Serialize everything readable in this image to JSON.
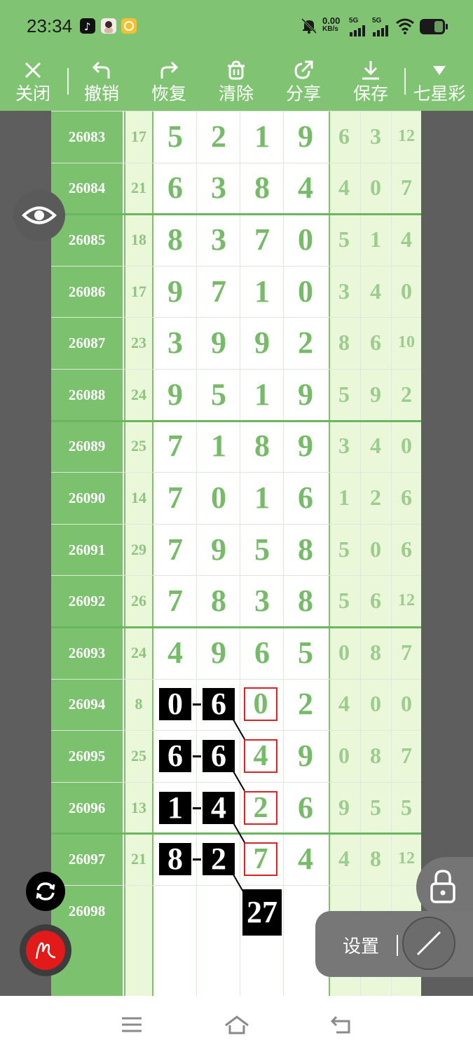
{
  "status_bar": {
    "time": "23:34",
    "speed_value": "0.00",
    "speed_unit": "KB/s",
    "network1": "5G",
    "network2": "5G"
  },
  "toolbar": {
    "close": "关闭",
    "undo": "撤销",
    "redo": "恢复",
    "clear": "清除",
    "share": "分享",
    "save": "保存",
    "lottery": "七星彩"
  },
  "rows": [
    {
      "id": "26083",
      "sum": "17",
      "digits": [
        "5",
        "2",
        "1",
        "9"
      ],
      "tail": [
        "6",
        "3",
        "12"
      ]
    },
    {
      "id": "26084",
      "sum": "21",
      "digits": [
        "6",
        "3",
        "8",
        "4"
      ],
      "tail": [
        "4",
        "0",
        "7"
      ]
    },
    {
      "id": "26085",
      "sum": "18",
      "digits": [
        "8",
        "3",
        "7",
        "0"
      ],
      "tail": [
        "5",
        "1",
        "4"
      ]
    },
    {
      "id": "26086",
      "sum": "17",
      "digits": [
        "9",
        "7",
        "1",
        "0"
      ],
      "tail": [
        "3",
        "4",
        "0"
      ]
    },
    {
      "id": "26087",
      "sum": "23",
      "digits": [
        "3",
        "9",
        "9",
        "2"
      ],
      "tail": [
        "8",
        "6",
        "10"
      ]
    },
    {
      "id": "26088",
      "sum": "24",
      "digits": [
        "9",
        "5",
        "1",
        "9"
      ],
      "tail": [
        "5",
        "9",
        "2"
      ]
    },
    {
      "id": "26089",
      "sum": "25",
      "digits": [
        "7",
        "1",
        "8",
        "9"
      ],
      "tail": [
        "3",
        "4",
        "0"
      ]
    },
    {
      "id": "26090",
      "sum": "14",
      "digits": [
        "7",
        "0",
        "1",
        "6"
      ],
      "tail": [
        "1",
        "2",
        "6"
      ]
    },
    {
      "id": "26091",
      "sum": "29",
      "digits": [
        "7",
        "9",
        "5",
        "8"
      ],
      "tail": [
        "5",
        "0",
        "6"
      ]
    },
    {
      "id": "26092",
      "sum": "26",
      "digits": [
        "7",
        "8",
        "3",
        "8"
      ],
      "tail": [
        "5",
        "6",
        "12"
      ]
    },
    {
      "id": "26093",
      "sum": "24",
      "digits": [
        "4",
        "9",
        "6",
        "5"
      ],
      "tail": [
        "0",
        "8",
        "7"
      ]
    },
    {
      "id": "26094",
      "sum": "8",
      "digits": [
        "0",
        "6",
        "0",
        "2"
      ],
      "tail": [
        "4",
        "0",
        "0"
      ]
    },
    {
      "id": "26095",
      "sum": "25",
      "digits": [
        "6",
        "6",
        "4",
        "9"
      ],
      "tail": [
        "0",
        "8",
        "7"
      ]
    },
    {
      "id": "26096",
      "sum": "13",
      "digits": [
        "1",
        "4",
        "2",
        "6"
      ],
      "tail": [
        "9",
        "5",
        "5"
      ]
    },
    {
      "id": "26097",
      "sum": "21",
      "digits": [
        "8",
        "2",
        "7",
        "4"
      ],
      "tail": [
        "4",
        "8",
        "12"
      ]
    },
    {
      "id": "26098",
      "sum": "",
      "digits": [
        "",
        "",
        "",
        ""
      ],
      "tail": [
        "",
        "",
        ""
      ]
    }
  ],
  "annotation": {
    "result_label": "27",
    "highlight_color": "#d42525"
  },
  "settings": {
    "label": "设置"
  },
  "colors": {
    "accent": "#80c473",
    "digit": "#76bb68",
    "tail_bg": "#eaf7d8"
  }
}
